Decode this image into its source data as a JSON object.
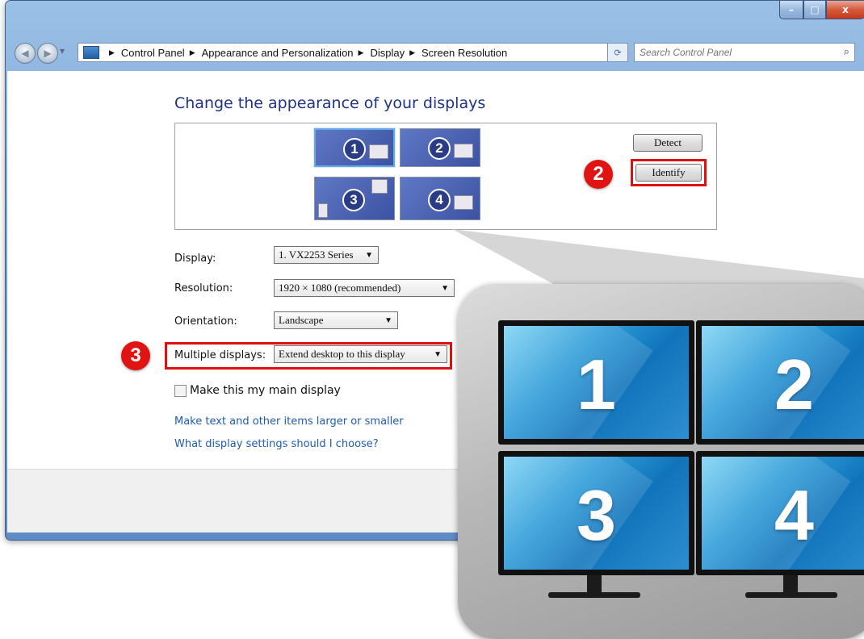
{
  "window": {
    "buttons": {
      "minimize": "–",
      "maximize": "□",
      "close": "x"
    }
  },
  "address": {
    "crumbs": [
      "Control Panel",
      "Appearance and Personalization",
      "Display",
      "Screen Resolution"
    ],
    "search_placeholder": "Search Control Panel"
  },
  "main": {
    "heading": "Change the appearance of your displays",
    "monitors": [
      "1",
      "2",
      "3",
      "4"
    ],
    "detect_label": "Detect",
    "identify_label": "Identify",
    "display_label": "Display:",
    "display_value": "1. VX2253 Series",
    "resolution_label": "Resolution:",
    "resolution_value": "1920 × 1080 (recommended)",
    "orientation_label": "Orientation:",
    "orientation_value": "Landscape",
    "multiple_label": "Multiple displays:",
    "multiple_value": "Extend desktop to this display",
    "main_display_label": "Make this my main display",
    "link1": "Make text and other items larger or smaller",
    "link2": "What display settings should I choose?"
  },
  "badges": {
    "identify_step": "2",
    "multiple_step": "3"
  },
  "zoom": {
    "numbers": [
      "1",
      "2",
      "3",
      "4"
    ]
  },
  "colors": {
    "accent_red": "#e01010",
    "heading_blue": "#1e3287",
    "link_blue": "#1f5cb0"
  }
}
